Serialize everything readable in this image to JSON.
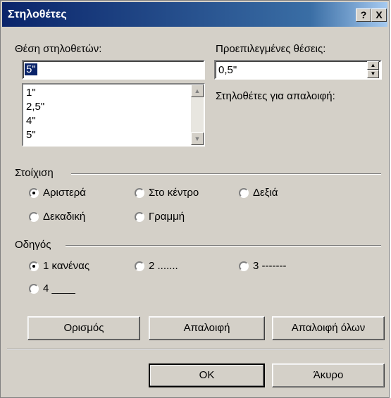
{
  "window": {
    "title": "Στηλοθέτες",
    "help_label": "?",
    "close_label": "X"
  },
  "tab_position": {
    "label": "Θέση στηλοθετών:",
    "value": "5\"",
    "list": [
      "1\"",
      "2,5\"",
      "4\"",
      "5\""
    ]
  },
  "default_stops": {
    "label": "Προεπιλεγμένες θέσεις:",
    "value": "0,5\""
  },
  "clear_label": "Στηλοθέτες για απαλοιφή:",
  "alignment": {
    "label": "Στοίχιση",
    "options": [
      "Αριστερά",
      "Στο κέντρο",
      "Δεξιά",
      "Δεκαδική",
      "Γραμμή"
    ],
    "selected": "Αριστερά"
  },
  "leader": {
    "label": "Οδηγός",
    "options": [
      "1 κανένας",
      "2 .......",
      "3 -------",
      "4 ____"
    ],
    "selected": "1 κανένας"
  },
  "buttons": {
    "set": "Ορισμός",
    "clear": "Απαλοιφή",
    "clear_all": "Απαλοιφή όλων",
    "ok": "OK",
    "cancel": "Άκυρο"
  }
}
